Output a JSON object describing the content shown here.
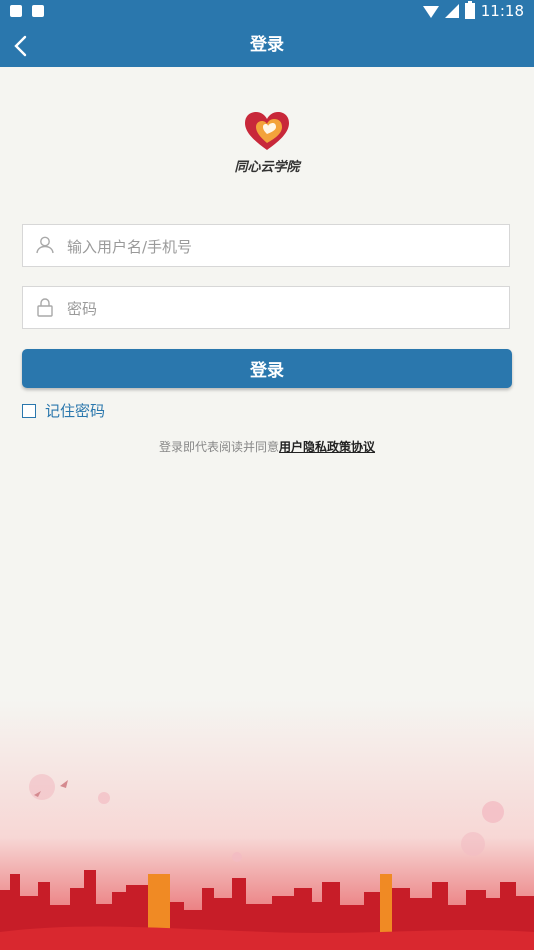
{
  "status_bar": {
    "time": "11:18"
  },
  "header": {
    "title": "登录"
  },
  "logo": {
    "text": "同心云学院"
  },
  "form": {
    "username_placeholder": "输入用户名/手机号",
    "password_placeholder": "密码",
    "login_label": "登录",
    "remember_label": "记住密码"
  },
  "agreement": {
    "prefix": "登录即代表阅读并同意",
    "link": "用户隐私政策协议"
  },
  "colors": {
    "primary": "#2a77ad",
    "background": "#f5f5f1",
    "logo_red": "#c8283a",
    "logo_orange": "#f3a33b"
  }
}
